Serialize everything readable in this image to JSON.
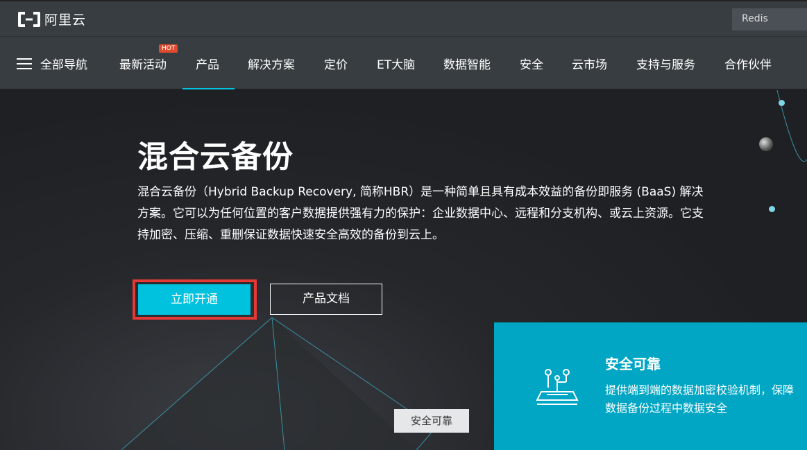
{
  "header": {
    "logo_text": "阿里云",
    "search_text": "Redis"
  },
  "nav": {
    "all_label": "全部导航",
    "hot_badge": "HOT",
    "items": [
      {
        "label": "最新活动"
      },
      {
        "label": "产品"
      },
      {
        "label": "解决方案"
      },
      {
        "label": "定价"
      },
      {
        "label": "ET大脑"
      },
      {
        "label": "数据智能"
      },
      {
        "label": "安全"
      },
      {
        "label": "云市场"
      },
      {
        "label": "支持与服务"
      },
      {
        "label": "合作伙伴"
      }
    ],
    "active_item": "产品",
    "accent_color": "#00c1de"
  },
  "hero": {
    "title": "混合云备份",
    "description": "混合云备份（Hybrid Backup Recovery, 简称HBR）是一种简单且具有成本效益的备份即服务 (BaaS) 解决方案。它可以为任何位置的客户数据提供强有力的保护：企业数据中心、远程和分支机构、或云上资源。它支持加密、压缩、重删保证数据快速安全高效的备份到云上。",
    "primary_button": "立即开通",
    "secondary_button": "产品文档",
    "floating_tag": "安全可靠"
  },
  "feature": {
    "title": "安全可靠",
    "text": "提供端到端的数据加密校验机制，保障数据备份过程中数据安全",
    "icon": "shield-circuit-icon",
    "background_color": "#00a6c4"
  }
}
